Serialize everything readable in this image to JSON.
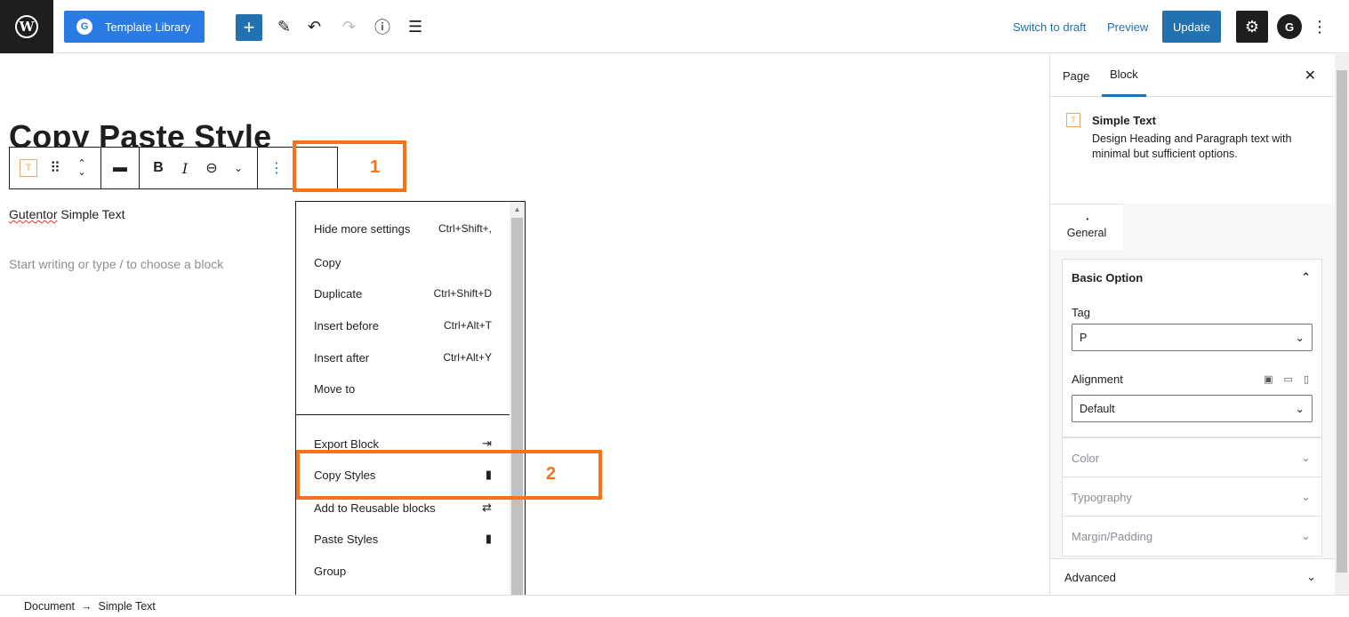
{
  "topbar": {
    "template_library_label": "Template Library",
    "template_library_badge": "G",
    "switch_to_draft": "Switch to draft",
    "preview": "Preview",
    "update": "Update",
    "wp_logo": "W",
    "gutentor_badge": "G",
    "icons": [
      "wordpress-logo",
      "add-block-plus",
      "pencil-tools",
      "undo",
      "redo",
      "info",
      "list-view",
      "settings-gear",
      "gutentor",
      "options-kebab"
    ]
  },
  "editor": {
    "title": "Copy Paste Style",
    "paragraph_prefix": "Gutentor",
    "paragraph_suffix": " Simple Text",
    "placeholder": "Start writing or type / to choose a block",
    "toolbar": {
      "block_icon": "T",
      "bold": "B",
      "italic": "I"
    }
  },
  "callouts": [
    {
      "number": "1",
      "color": "#f97316"
    },
    {
      "number": "2",
      "color": "#f97316"
    }
  ],
  "menu": {
    "items": [
      {
        "label": "Hide more settings",
        "shortcut": "Ctrl+Shift+,"
      },
      {
        "label": "Copy",
        "shortcut": ""
      },
      {
        "label": "Duplicate",
        "shortcut": "Ctrl+Shift+D"
      },
      {
        "label": "Insert before",
        "shortcut": "Ctrl+Alt+T"
      },
      {
        "label": "Insert after",
        "shortcut": "Ctrl+Alt+Y"
      },
      {
        "label": "Move to",
        "shortcut": ""
      },
      {
        "label": "Export Block",
        "icon": "export-icon"
      },
      {
        "label": "Copy Styles",
        "icon": "copy-icon"
      },
      {
        "label": "Add to Reusable blocks",
        "icon": "reusable-icon"
      },
      {
        "label": "Paste Styles",
        "icon": "paste-icon"
      },
      {
        "label": "Group",
        "shortcut": ""
      }
    ]
  },
  "sidebar": {
    "tabs": [
      "Page",
      "Block"
    ],
    "active_tab": "Block",
    "block_card": {
      "title": "Simple Text",
      "description": "Design Heading and Paragraph text with minimal but sufficient options."
    },
    "general_tab": "General",
    "basic_option": {
      "title": "Basic Option",
      "tag_label": "Tag",
      "tag_value": "P",
      "alignment_label": "Alignment",
      "alignment_value": "Default"
    },
    "collapsed_panels": [
      "Color",
      "Typography",
      "Margin/Padding"
    ],
    "advanced": "Advanced"
  },
  "footer": {
    "crumb_root": "Document",
    "arrow": "→",
    "crumb_current": "Simple Text"
  },
  "colors": {
    "accent": "#2271b1",
    "template_button": "#2a7be4",
    "highlight": "#f97316"
  }
}
